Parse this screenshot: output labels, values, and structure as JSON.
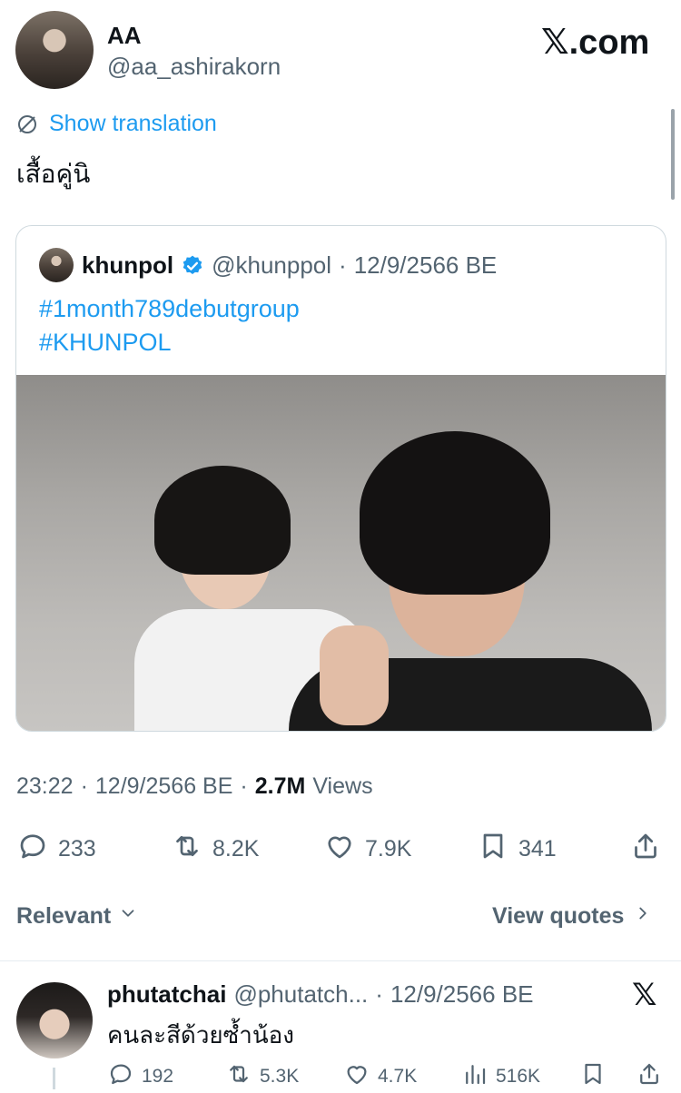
{
  "author": {
    "name": "AA",
    "handle": "@aa_ashirakorn"
  },
  "brand": {
    "logo": "𝕏",
    "label": ".com"
  },
  "translate": {
    "label": "Show translation",
    "icon": "translate-icon"
  },
  "tweet": {
    "text": "เสื้อคู่นิ"
  },
  "quoted": {
    "name": "khunpol",
    "handle": "@khunppol",
    "date": "12/9/2566 BE",
    "separator": "·",
    "hashtags": [
      "#1month789debutgroup",
      "#KHUNPOL"
    ],
    "verified": true
  },
  "meta": {
    "time": "23:22",
    "sep1": "·",
    "date": "12/9/2566 BE",
    "sep2": "·",
    "views_count": "2.7M",
    "views_label": "Views"
  },
  "actions": {
    "replies": "233",
    "retweets": "8.2K",
    "likes": "7.9K",
    "bookmarks": "341"
  },
  "sort": {
    "relevant_label": "Relevant",
    "view_quotes_label": "View quotes"
  },
  "reply": {
    "name": "phutatchai",
    "handle": "@phutatch...",
    "separator": "·",
    "date": "12/9/2566 BE",
    "text": "คนละสีด้วยซ้ำน้อง",
    "actions": {
      "replies": "192",
      "retweets": "5.3K",
      "likes": "4.7K",
      "views": "516K"
    }
  },
  "colors": {
    "accent": "#1d9bf0",
    "muted": "#536471",
    "text": "#0f1419",
    "border": "#cfd9de"
  }
}
